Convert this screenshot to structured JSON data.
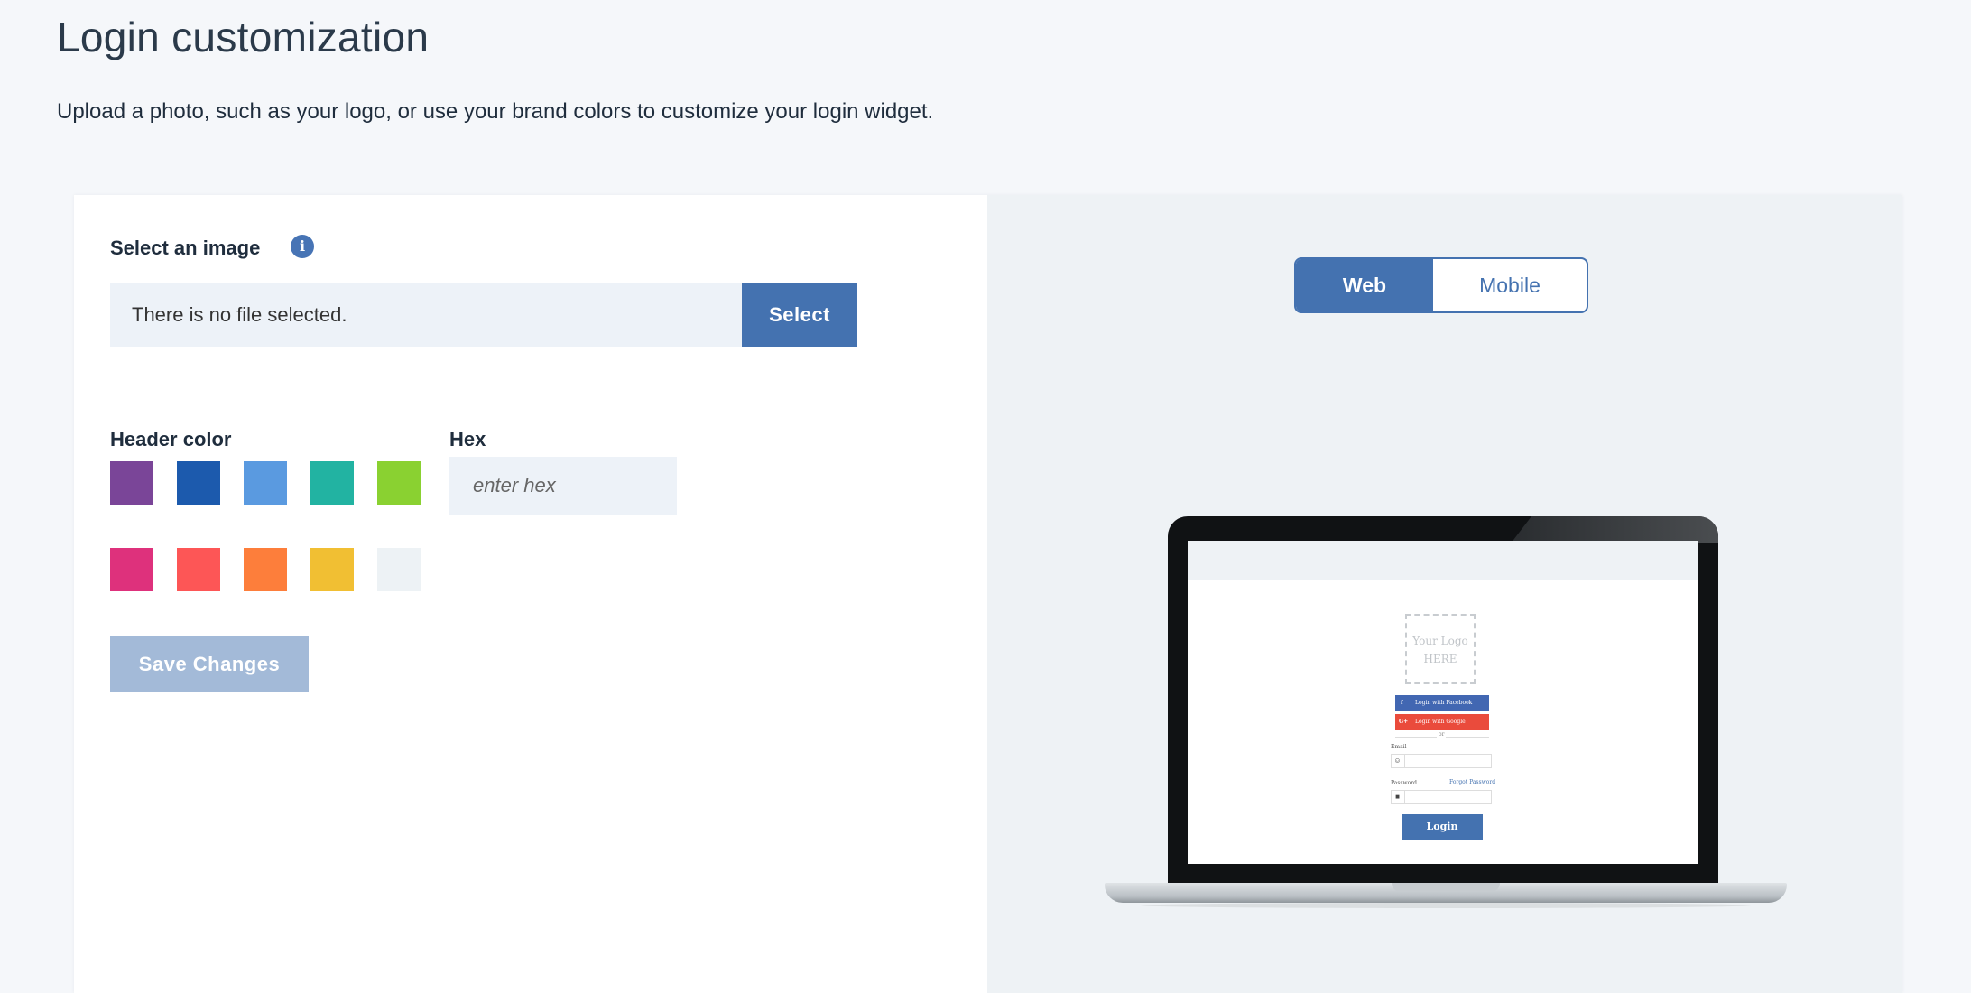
{
  "page": {
    "title": "Login customization",
    "subtitle": "Upload a photo, such as your logo, or use your brand colors to customize your login widget."
  },
  "image_section": {
    "label": "Select an image",
    "info_icon": "info-icon",
    "file_text": "There is no file selected.",
    "select_label": "Select"
  },
  "header_color": {
    "label": "Header color",
    "swatches": [
      "#7a4598",
      "#1c5aad",
      "#5a9ae0",
      "#22b3a2",
      "#8ad131",
      "#de317c",
      "#fd5656",
      "#fd7e3b",
      "#f1bf33",
      "#edf2f5"
    ]
  },
  "hex": {
    "label": "Hex",
    "placeholder": "enter hex"
  },
  "save_label": "Save Changes",
  "preview": {
    "toggle": {
      "web": "Web",
      "mobile": "Mobile",
      "active": "web"
    },
    "logo_text": "Your Logo HERE",
    "logo_line1": "Your Logo",
    "logo_line2": "HERE",
    "facebook_label": "Login with Facebook",
    "google_label": "Login with Google",
    "or_text": "or",
    "email_label": "Email",
    "password_label": "Password",
    "forgot_label": "Forgot Password",
    "login_label": "Login"
  },
  "colors": {
    "accent": "#4472b0",
    "save_disabled": "#a3bad8",
    "input_bg": "#edf2f8",
    "preview_bg": "#eef2f5"
  }
}
